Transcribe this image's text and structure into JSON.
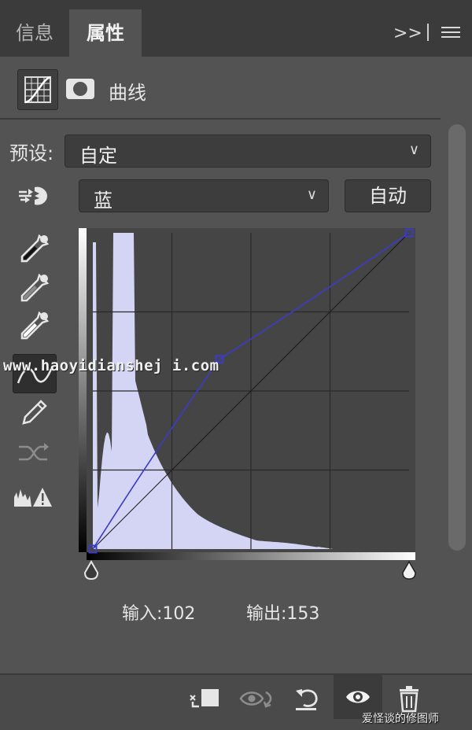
{
  "tabs": [
    {
      "label": "信息",
      "active": false
    },
    {
      "label": "属性",
      "active": true
    }
  ],
  "header": {
    "title": "曲线"
  },
  "preset": {
    "label": "预设:",
    "value": "自定"
  },
  "channel": {
    "value": "蓝",
    "auto_label": "自动"
  },
  "readout": {
    "input": "输入:102",
    "output": "输出:153"
  },
  "curve": {
    "channel_color": "#3b3bc8",
    "points": [
      [
        0,
        0
      ],
      [
        102,
        153
      ],
      [
        255,
        255
      ]
    ],
    "histogram_color": "#d4d4f4"
  },
  "watermark": "www.haoyidianshej i.com",
  "weibo_credit": "爱怪谈的修图师",
  "icons": {
    "panel_menu": "hamburger-icon",
    "collapse": "double-chevron-icon",
    "curves_mode": "curves-adjustment-icon",
    "mask": "mask-icon",
    "on_image": "targeted-adjustment-icon",
    "eyedroppers": [
      "black-point-eyedropper-icon",
      "gray-point-eyedropper-icon",
      "white-point-eyedropper-icon"
    ],
    "tools": [
      "point-curve-icon",
      "pencil-icon",
      "smooth-icon",
      "clipping-warning-icon"
    ],
    "bottom": [
      "clip-to-layer-icon",
      "view-previous-icon",
      "reset-icon",
      "visibility-icon",
      "delete-icon"
    ]
  }
}
